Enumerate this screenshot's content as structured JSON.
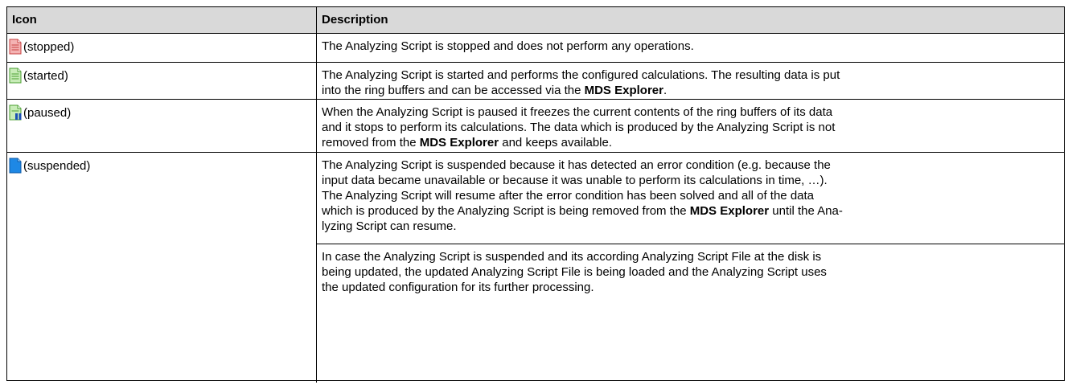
{
  "headers": {
    "icon": "Icon",
    "description": "Description"
  },
  "rows": [
    {
      "icon_name": "document-stopped-icon",
      "icon_color": "#e46a6a",
      "state": "(stopped)",
      "desc": [
        "The Analyzing Script is stopped and does not perform any operations."
      ]
    },
    {
      "icon_name": "document-started-icon",
      "icon_color": "#7ccf5e",
      "state": "(started)",
      "desc": [
        "The Analyzing Script is started and performs the configured calculations. The resulting data is put",
        "into the ring buffers and can be accessed via the ",
        "MDS Explorer",
        "."
      ]
    },
    {
      "icon_name": "document-paused-icon",
      "icon_color": "#7ccf5e",
      "pause_color": "#1a4fb3",
      "state": "(paused)",
      "desc": [
        "When the Analyzing Script is paused it freezes the current contents of the ring buffers of its data",
        "and it stops to perform its calculations. The data which is produced by the Analyzing Script is not",
        "removed from the ",
        "MDS Explorer",
        " and keeps available."
      ]
    },
    {
      "icon_name": "document-suspended-icon",
      "icon_color": "#1e88e5",
      "state": "(suspended)",
      "desc": [
        "The Analyzing Script is suspended because it has detected an error condition (e.g. because the",
        "input data became unavailable or because it was unable to perform its calculations in time, …).",
        "The Analyzing Script will resume after the error condition has been solved and all of the data",
        "which is produced by the Analyzing Script is being removed from the ",
        "MDS Explorer",
        " until the Ana-",
        "lyzing Script can resume."
      ]
    },
    {
      "desc": [
        "In case the Analyzing Script is suspended and its according Analyzing Script File at the disk is",
        "being updated, the updated Analyzing Script File is being loaded and the Analyzing Script uses",
        "the updated configuration for its further processing."
      ]
    }
  ]
}
